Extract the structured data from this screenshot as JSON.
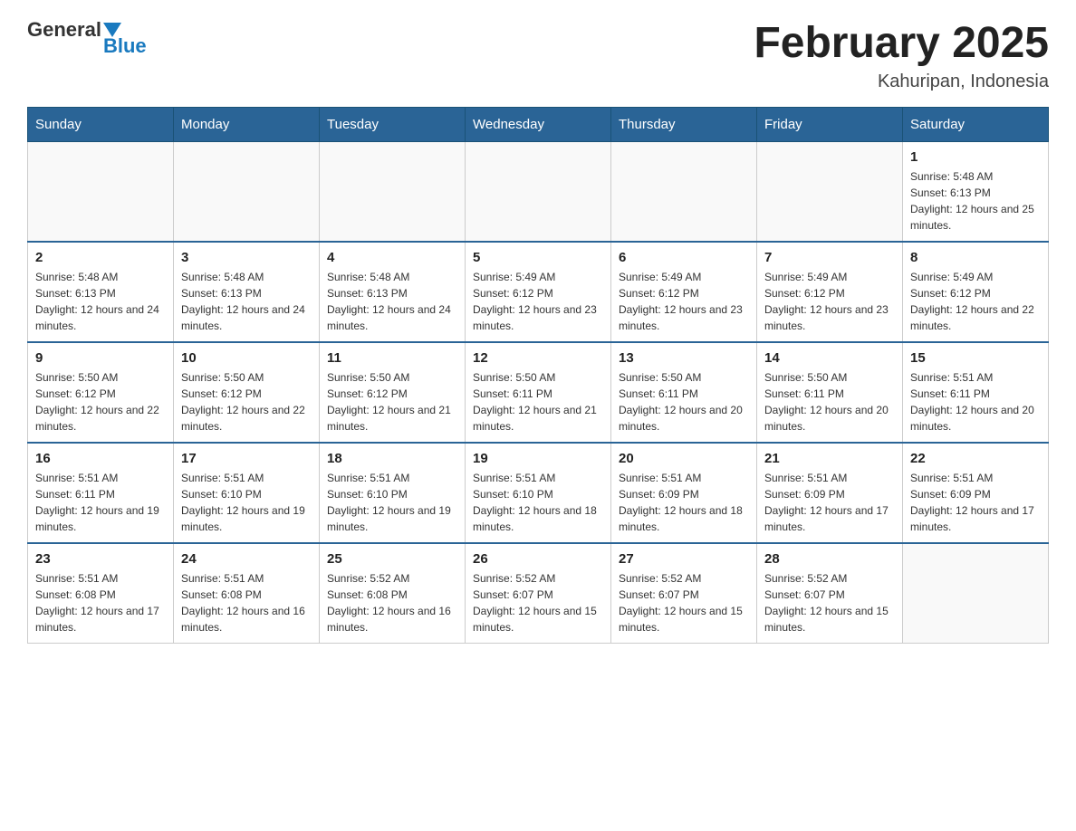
{
  "logo": {
    "general": "General",
    "blue": "Blue"
  },
  "header": {
    "title": "February 2025",
    "location": "Kahuripan, Indonesia"
  },
  "weekdays": [
    "Sunday",
    "Monday",
    "Tuesday",
    "Wednesday",
    "Thursday",
    "Friday",
    "Saturday"
  ],
  "weeks": [
    [
      {
        "day": "",
        "sunrise": "",
        "sunset": "",
        "daylight": ""
      },
      {
        "day": "",
        "sunrise": "",
        "sunset": "",
        "daylight": ""
      },
      {
        "day": "",
        "sunrise": "",
        "sunset": "",
        "daylight": ""
      },
      {
        "day": "",
        "sunrise": "",
        "sunset": "",
        "daylight": ""
      },
      {
        "day": "",
        "sunrise": "",
        "sunset": "",
        "daylight": ""
      },
      {
        "day": "",
        "sunrise": "",
        "sunset": "",
        "daylight": ""
      },
      {
        "day": "1",
        "sunrise": "Sunrise: 5:48 AM",
        "sunset": "Sunset: 6:13 PM",
        "daylight": "Daylight: 12 hours and 25 minutes."
      }
    ],
    [
      {
        "day": "2",
        "sunrise": "Sunrise: 5:48 AM",
        "sunset": "Sunset: 6:13 PM",
        "daylight": "Daylight: 12 hours and 24 minutes."
      },
      {
        "day": "3",
        "sunrise": "Sunrise: 5:48 AM",
        "sunset": "Sunset: 6:13 PM",
        "daylight": "Daylight: 12 hours and 24 minutes."
      },
      {
        "day": "4",
        "sunrise": "Sunrise: 5:48 AM",
        "sunset": "Sunset: 6:13 PM",
        "daylight": "Daylight: 12 hours and 24 minutes."
      },
      {
        "day": "5",
        "sunrise": "Sunrise: 5:49 AM",
        "sunset": "Sunset: 6:12 PM",
        "daylight": "Daylight: 12 hours and 23 minutes."
      },
      {
        "day": "6",
        "sunrise": "Sunrise: 5:49 AM",
        "sunset": "Sunset: 6:12 PM",
        "daylight": "Daylight: 12 hours and 23 minutes."
      },
      {
        "day": "7",
        "sunrise": "Sunrise: 5:49 AM",
        "sunset": "Sunset: 6:12 PM",
        "daylight": "Daylight: 12 hours and 23 minutes."
      },
      {
        "day": "8",
        "sunrise": "Sunrise: 5:49 AM",
        "sunset": "Sunset: 6:12 PM",
        "daylight": "Daylight: 12 hours and 22 minutes."
      }
    ],
    [
      {
        "day": "9",
        "sunrise": "Sunrise: 5:50 AM",
        "sunset": "Sunset: 6:12 PM",
        "daylight": "Daylight: 12 hours and 22 minutes."
      },
      {
        "day": "10",
        "sunrise": "Sunrise: 5:50 AM",
        "sunset": "Sunset: 6:12 PM",
        "daylight": "Daylight: 12 hours and 22 minutes."
      },
      {
        "day": "11",
        "sunrise": "Sunrise: 5:50 AM",
        "sunset": "Sunset: 6:12 PM",
        "daylight": "Daylight: 12 hours and 21 minutes."
      },
      {
        "day": "12",
        "sunrise": "Sunrise: 5:50 AM",
        "sunset": "Sunset: 6:11 PM",
        "daylight": "Daylight: 12 hours and 21 minutes."
      },
      {
        "day": "13",
        "sunrise": "Sunrise: 5:50 AM",
        "sunset": "Sunset: 6:11 PM",
        "daylight": "Daylight: 12 hours and 20 minutes."
      },
      {
        "day": "14",
        "sunrise": "Sunrise: 5:50 AM",
        "sunset": "Sunset: 6:11 PM",
        "daylight": "Daylight: 12 hours and 20 minutes."
      },
      {
        "day": "15",
        "sunrise": "Sunrise: 5:51 AM",
        "sunset": "Sunset: 6:11 PM",
        "daylight": "Daylight: 12 hours and 20 minutes."
      }
    ],
    [
      {
        "day": "16",
        "sunrise": "Sunrise: 5:51 AM",
        "sunset": "Sunset: 6:11 PM",
        "daylight": "Daylight: 12 hours and 19 minutes."
      },
      {
        "day": "17",
        "sunrise": "Sunrise: 5:51 AM",
        "sunset": "Sunset: 6:10 PM",
        "daylight": "Daylight: 12 hours and 19 minutes."
      },
      {
        "day": "18",
        "sunrise": "Sunrise: 5:51 AM",
        "sunset": "Sunset: 6:10 PM",
        "daylight": "Daylight: 12 hours and 19 minutes."
      },
      {
        "day": "19",
        "sunrise": "Sunrise: 5:51 AM",
        "sunset": "Sunset: 6:10 PM",
        "daylight": "Daylight: 12 hours and 18 minutes."
      },
      {
        "day": "20",
        "sunrise": "Sunrise: 5:51 AM",
        "sunset": "Sunset: 6:09 PM",
        "daylight": "Daylight: 12 hours and 18 minutes."
      },
      {
        "day": "21",
        "sunrise": "Sunrise: 5:51 AM",
        "sunset": "Sunset: 6:09 PM",
        "daylight": "Daylight: 12 hours and 17 minutes."
      },
      {
        "day": "22",
        "sunrise": "Sunrise: 5:51 AM",
        "sunset": "Sunset: 6:09 PM",
        "daylight": "Daylight: 12 hours and 17 minutes."
      }
    ],
    [
      {
        "day": "23",
        "sunrise": "Sunrise: 5:51 AM",
        "sunset": "Sunset: 6:08 PM",
        "daylight": "Daylight: 12 hours and 17 minutes."
      },
      {
        "day": "24",
        "sunrise": "Sunrise: 5:51 AM",
        "sunset": "Sunset: 6:08 PM",
        "daylight": "Daylight: 12 hours and 16 minutes."
      },
      {
        "day": "25",
        "sunrise": "Sunrise: 5:52 AM",
        "sunset": "Sunset: 6:08 PM",
        "daylight": "Daylight: 12 hours and 16 minutes."
      },
      {
        "day": "26",
        "sunrise": "Sunrise: 5:52 AM",
        "sunset": "Sunset: 6:07 PM",
        "daylight": "Daylight: 12 hours and 15 minutes."
      },
      {
        "day": "27",
        "sunrise": "Sunrise: 5:52 AM",
        "sunset": "Sunset: 6:07 PM",
        "daylight": "Daylight: 12 hours and 15 minutes."
      },
      {
        "day": "28",
        "sunrise": "Sunrise: 5:52 AM",
        "sunset": "Sunset: 6:07 PM",
        "daylight": "Daylight: 12 hours and 15 minutes."
      },
      {
        "day": "",
        "sunrise": "",
        "sunset": "",
        "daylight": ""
      }
    ]
  ]
}
